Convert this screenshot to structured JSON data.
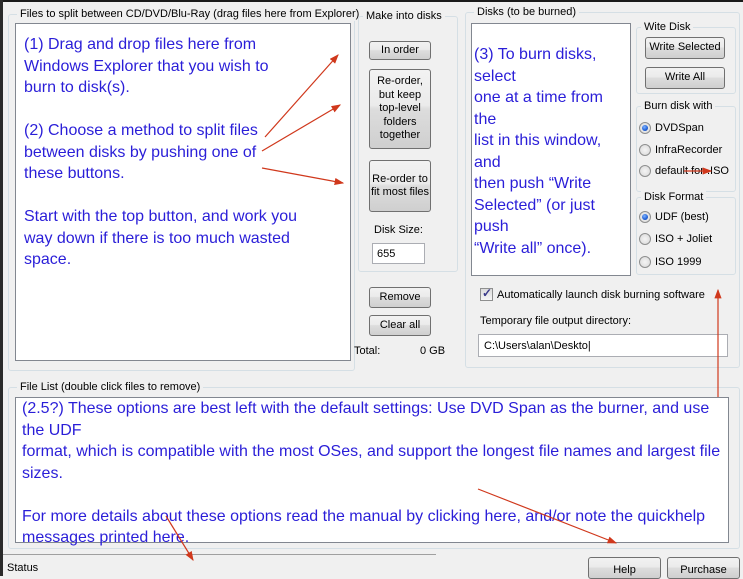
{
  "files_panel": {
    "legend": "Files to split between CD/DVD/Blu-Ray (drag files here from Explorer)",
    "note": "(1) Drag and drop files here from\nWindows Explorer that you wish to\nburn to disk(s).\n\n(2) Choose a method to split files\nbetween disks by pushing one of\nthese buttons.\n\nStart with the top button, and work you\nway down if there is too much wasted\nspace."
  },
  "make_disks": {
    "legend": "Make into disks",
    "in_order_label": "In order",
    "reorder_keep_label": "Re-order,\nbut keep\ntop-level\nfolders\ntogether",
    "reorder_fit_label": "Re-order to\nfit most files",
    "disk_size_label": "Disk Size:",
    "disk_size_value": "655"
  },
  "file_actions": {
    "remove_label": "Remove",
    "clear_all_label": "Clear all",
    "total_label": "Total:",
    "total_value": "0 GB"
  },
  "disks_panel": {
    "legend": "Disks (to be burned)",
    "note": "(3) To burn disks, select\none at a time from the\nlist in this window, and\nthen push “Write\nSelected” (or just push\n“Write all” once)."
  },
  "write_disk": {
    "legend": "Wite Disk",
    "write_selected_label": "Write Selected",
    "write_all_label": "Write All"
  },
  "burn_with": {
    "legend": "Burn disk with",
    "options": [
      {
        "label": "DVDSpan",
        "selected": true
      },
      {
        "label": "InfraRecorder",
        "selected": false
      },
      {
        "label": "default for .ISO",
        "selected": false
      }
    ]
  },
  "disk_format": {
    "legend": "Disk Format",
    "options": [
      {
        "label": "UDF (best)",
        "selected": true
      },
      {
        "label": "ISO + Joliet",
        "selected": false
      },
      {
        "label": "ISO 1999",
        "selected": false
      }
    ]
  },
  "auto_launch": {
    "label": "Automatically launch disk burning software",
    "checked": true
  },
  "temp_dir": {
    "label": "Temporary file output directory:",
    "value": "C:\\Users\\alan\\Deskto|"
  },
  "file_list": {
    "legend": "File List   (double click files to remove)",
    "note": "(2.5?) These options are best left with the default settings: Use DVD Span as the burner, and use the UDF\nformat, which is compatible with the most OSes, and support the longest file names and largest file sizes.\n\nFor more details about these options read the manual by clicking here, and/or note the quickhelp\nmessages printed here."
  },
  "status_bar": {
    "status_label": "Status",
    "help_label": "Help",
    "purchase_label": "Purchase"
  },
  "colors": {
    "annotation_text": "#2a1ed8",
    "annotation_arrow": "#d0381c",
    "radio_selected": "#1f5fd6"
  }
}
